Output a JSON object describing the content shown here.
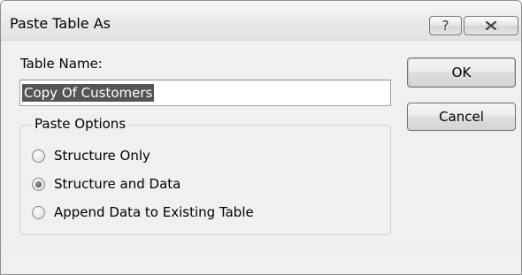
{
  "window": {
    "title": "Paste Table As",
    "help_glyph": "?",
    "close_icon": "close-icon"
  },
  "form": {
    "table_name_label": "Table Name:",
    "table_name_value": "Copy Of Customers"
  },
  "buttons": {
    "ok_label": "OK",
    "cancel_label": "Cancel"
  },
  "paste_options": {
    "legend": "Paste Options",
    "options": [
      {
        "label": "Structure Only",
        "selected": false
      },
      {
        "label": "Structure and Data",
        "selected": true
      },
      {
        "label": "Append Data to Existing Table",
        "selected": false
      }
    ]
  }
}
